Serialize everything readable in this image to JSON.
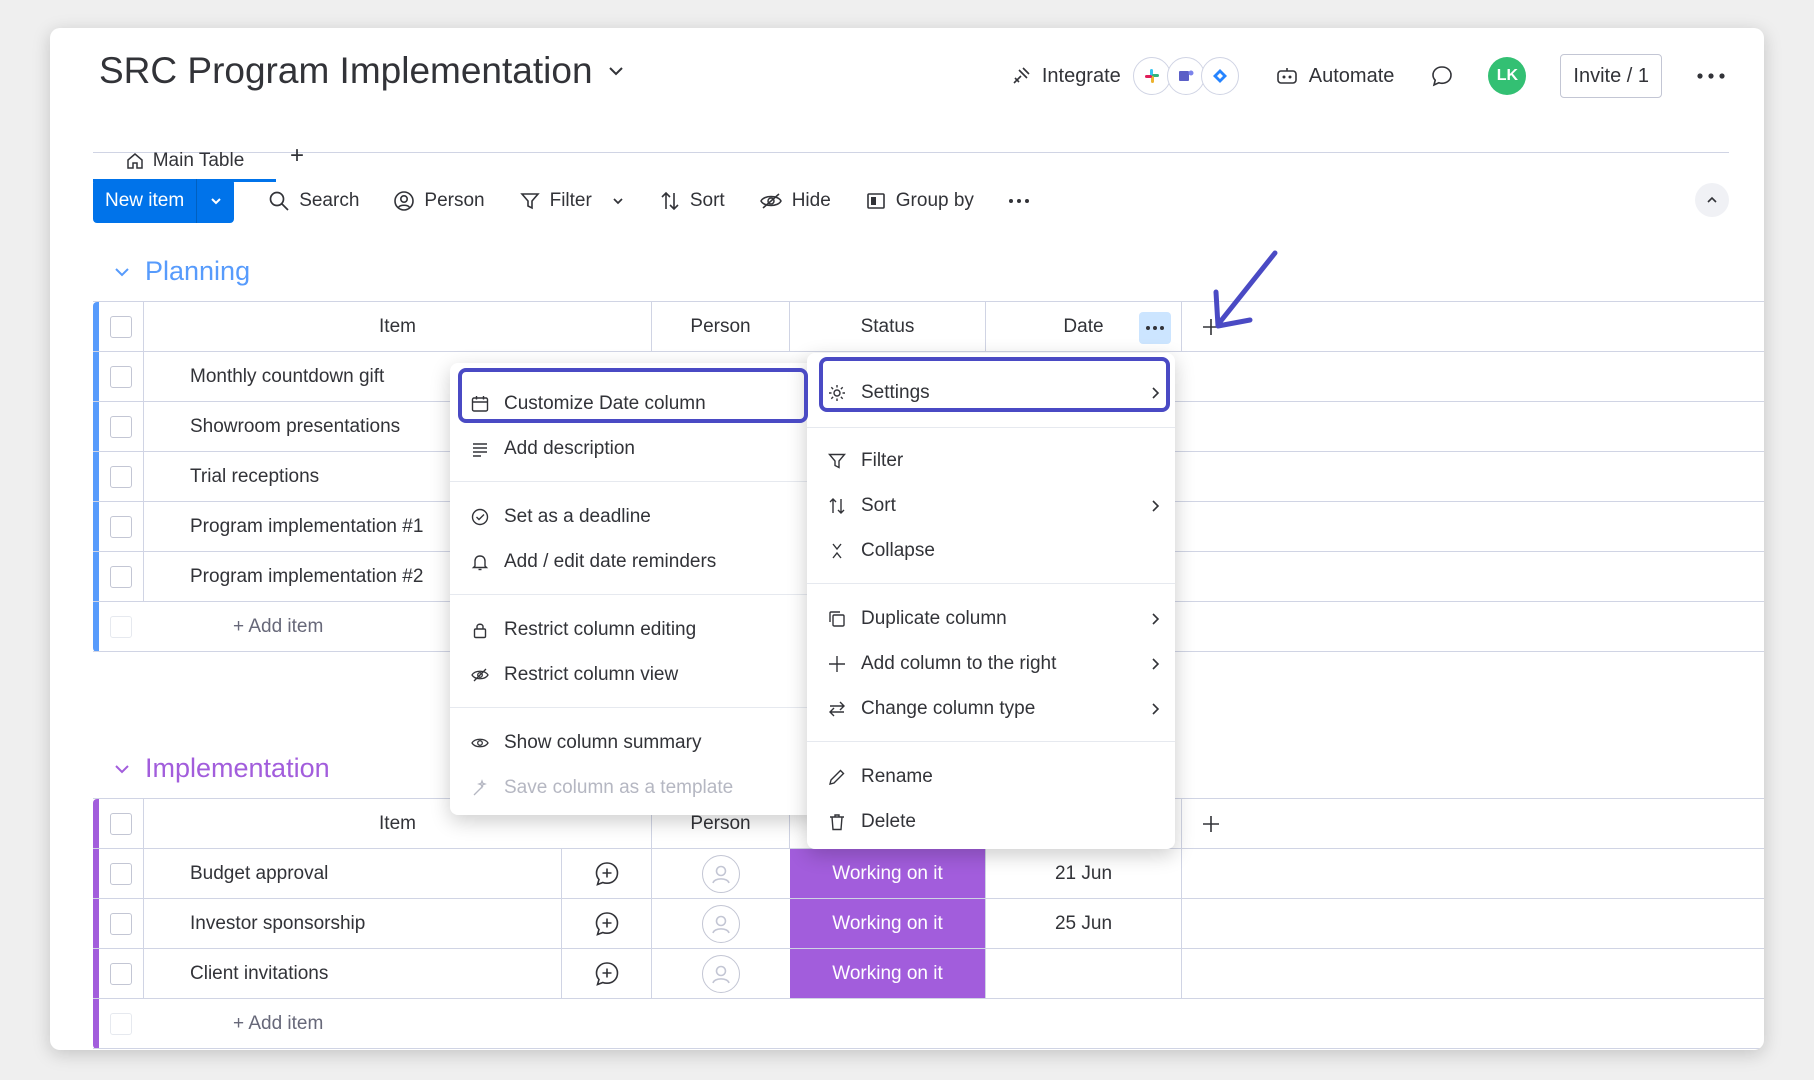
{
  "header": {
    "title": "SRC Program Implementation",
    "integrate_label": "Integrate",
    "automate_label": "Automate",
    "avatar_initials": "LK",
    "invite_label": "Invite / 1"
  },
  "tabs": {
    "main_label": "Main Table",
    "add_label": "+"
  },
  "toolbar": {
    "new_item_label": "New item",
    "search_label": "Search",
    "person_label": "Person",
    "filter_label": "Filter",
    "sort_label": "Sort",
    "hide_label": "Hide",
    "group_by_label": "Group by"
  },
  "groups": [
    {
      "title": "Planning",
      "color": "#579bfc",
      "columns": {
        "item": "Item",
        "person": "Person",
        "status": "Status",
        "date": "Date"
      },
      "rows": [
        {
          "item": "Monthly countdown gift"
        },
        {
          "item": "Showroom presentations"
        },
        {
          "item": "Trial receptions"
        },
        {
          "item": "Program implementation #1"
        },
        {
          "item": "Program implementation #2"
        }
      ],
      "add_item_label": "+ Add item"
    },
    {
      "title": "Implementation",
      "color": "#a25ddc",
      "columns": {
        "item": "Item",
        "person": "Person"
      },
      "rows": [
        {
          "item": "Budget approval",
          "status": "Working on it",
          "date": "21 Jun"
        },
        {
          "item": "Investor sponsorship",
          "status": "Working on it",
          "date": "25 Jun"
        },
        {
          "item": "Client invitations",
          "status": "Working on it",
          "date": ""
        }
      ],
      "add_item_label": "+ Add item"
    }
  ],
  "column_menu": {
    "items": [
      {
        "label": "Customize Date column",
        "icon": "calendar-icon"
      },
      {
        "label": "Add description",
        "icon": "description-icon"
      },
      {
        "label": "Set as a deadline",
        "icon": "check-circle-icon"
      },
      {
        "label": "Add / edit date reminders",
        "icon": "bell-icon"
      },
      {
        "label": "Restrict column editing",
        "icon": "lock-icon"
      },
      {
        "label": "Restrict column view",
        "icon": "eye-off-icon"
      },
      {
        "label": "Show column summary",
        "icon": "eye-icon"
      },
      {
        "label": "Save column as a template",
        "icon": "magic-icon"
      }
    ]
  },
  "settings_menu": {
    "items": [
      {
        "label": "Settings",
        "icon": "gear-icon"
      },
      {
        "label": "Filter",
        "icon": "filter-icon"
      },
      {
        "label": "Sort",
        "icon": "sort-icon"
      },
      {
        "label": "Collapse",
        "icon": "collapse-icon"
      },
      {
        "label": "Duplicate column",
        "icon": "duplicate-icon"
      },
      {
        "label": "Add column to the right",
        "icon": "plus-icon"
      },
      {
        "label": "Change column type",
        "icon": "swap-icon"
      },
      {
        "label": "Rename",
        "icon": "pencil-icon"
      },
      {
        "label": "Delete",
        "icon": "trash-icon"
      }
    ]
  },
  "colors": {
    "primary": "#0073ea",
    "highlight": "#4a4ac4",
    "status_working": "#a25ddc"
  }
}
